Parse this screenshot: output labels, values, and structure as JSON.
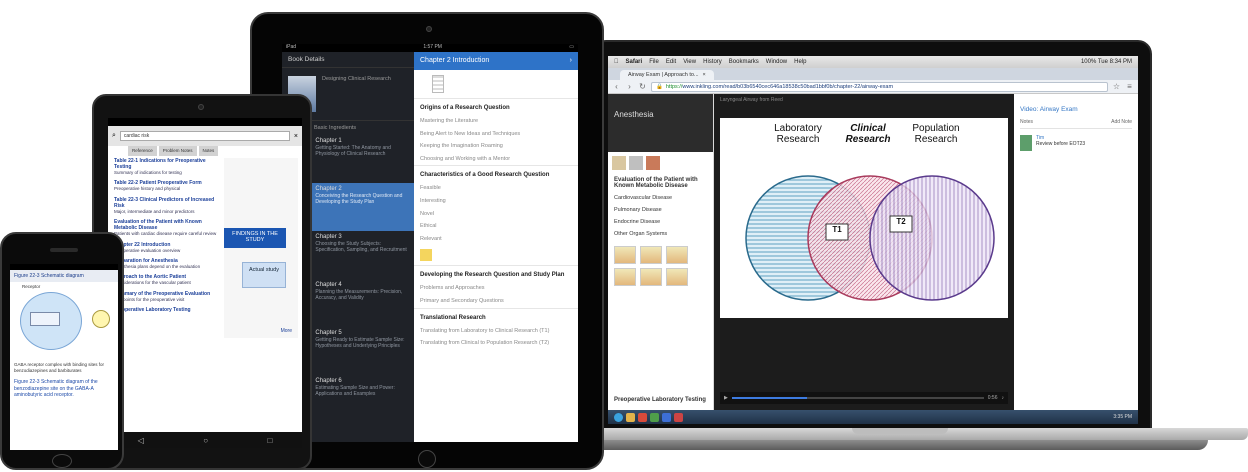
{
  "laptop": {
    "menubar": [
      "Safari",
      "File",
      "Edit",
      "View",
      "History",
      "Bookmarks",
      "Window",
      "Help"
    ],
    "menubar_right": "100%  Tue 8:34 PM",
    "tab_label": "Airway Exam | Approach to...",
    "url_scheme": "https://",
    "url": "www.inkling.com/read/b03b6540cec646a18538c50bad1bbf0b/chapter-22/airway-exam",
    "left_title": "Anesthesia",
    "left_toc": [
      {
        "text": "Evaluation of the Patient with Known Metabolic Disease",
        "bold": true
      },
      {
        "text": "Cardiovascular Disease",
        "bold": false
      },
      {
        "text": "Pulmonary Disease",
        "bold": false
      },
      {
        "text": "Endocrine Disease",
        "bold": false
      },
      {
        "text": "Other Organ Systems",
        "bold": false
      },
      {
        "text": "Preoperative Laboratory Testing",
        "bold": true
      }
    ],
    "video_header": "Laryngeal Airway from Reed",
    "venn": {
      "left": "Laboratory\nResearch",
      "center": "Clinical\nResearch",
      "right": "Population\nResearch",
      "t1": "T1",
      "t2": "T2"
    },
    "video_time": "0:56",
    "right_video_label": "Video: Airway Exam",
    "notes_label": "Notes",
    "add_note": "Add Note",
    "note_author": "Tim",
    "note_text": "Review before EOT23",
    "taskbar_time": "3:35 PM",
    "colors": {
      "accent": "#3577c5",
      "taskbar": "#2a4060"
    }
  },
  "tablet_big": {
    "status_left": "iPad",
    "status_center": "1:57 PM",
    "left_header": "Book Details",
    "book_title": "Designing Clinical Research",
    "section_label": "Section 1: Basic Ingredients",
    "chapters": [
      {
        "word": "Chapter",
        "num": "1",
        "title": "Chapter 1",
        "desc": "Getting Started: The Anatomy and Physiology of Clinical Research",
        "active": false
      },
      {
        "word": "Chapter",
        "num": "2",
        "title": "Chapter 2",
        "desc": "Conceiving the Research Question and Developing the Study Plan",
        "active": true
      },
      {
        "word": "Chapter",
        "num": "3",
        "title": "Chapter 3",
        "desc": "Choosing the Study Subjects: Specification, Sampling, and Recruitment",
        "active": false
      },
      {
        "word": "Chapter",
        "num": "4",
        "title": "Chapter 4",
        "desc": "Planning the Measurements: Precision, Accuracy, and Validity",
        "active": false
      },
      {
        "word": "Chapter",
        "num": "5",
        "title": "Chapter 5",
        "desc": "Getting Ready to Estimate Sample Size: Hypotheses and Underlying Principles",
        "active": false
      },
      {
        "word": "Chapter",
        "num": "6",
        "title": "Chapter 6",
        "desc": "Estimating Sample Size and Power: Applications and Examples",
        "active": false
      }
    ],
    "right_header": "Chapter 2 Introduction",
    "toc": [
      {
        "heading": "Origins of a Research Question",
        "items": [
          "Mastering the Literature",
          "Being Alert to New Ideas and Techniques",
          "Keeping the Imagination Roaming",
          "Choosing and Working with a Mentor"
        ]
      },
      {
        "heading": "Characteristics of a Good Research Question",
        "items": [
          "Feasible",
          "Interesting",
          "Novel",
          "Ethical",
          "Relevant"
        ]
      },
      {
        "heading": "Developing the Research Question and Study Plan",
        "items": [
          "Problems and Approaches",
          "Primary and Secondary Questions"
        ]
      },
      {
        "heading": "Translational Research",
        "items": [
          "Translating from Laboratory to Clinical Research (T1)",
          "Translating from Clinical to Population Research (T2)"
        ]
      }
    ]
  },
  "tablet_small": {
    "search_value": "cardiac risk",
    "tabs": [
      "Reference",
      "Problem Notes",
      "Notes"
    ],
    "results": [
      {
        "title": "Table 22-1 Indications for Preoperative Testing",
        "desc": "Summary of indications for testing"
      },
      {
        "title": "Table 22-2 Patient Preoperative Form",
        "desc": "Preoperative history and physical"
      },
      {
        "title": "Table 22-3 Clinical Predictors of Increased Risk",
        "desc": "Major, intermediate and minor predictors"
      },
      {
        "title": "Evaluation of the Patient with Known Metabolic Disease",
        "desc": "Patients with cardiac disease require careful review"
      },
      {
        "title": "Chapter 22 Introduction",
        "desc": "Preoperative evaluation overview"
      },
      {
        "title": "Preparation for Anesthesia",
        "desc": "Anesthesia plans depend on the evaluation"
      },
      {
        "title": "Approach to the Aortic Patient",
        "desc": "Considerations for the vascular patient"
      },
      {
        "title": "Summary of the Preoperative Evaluation",
        "desc": "Key points for the preoperative visit"
      },
      {
        "title": "Preoperative Laboratory Testing",
        "desc": ""
      }
    ],
    "panel_box1": "FINDINGS IN THE STUDY",
    "panel_box2": "Actual study",
    "panel_more": "More"
  },
  "phone": {
    "header": "Figure 22-3 Schematic diagram",
    "diagram_label": "Receptor",
    "body_text": "GABA receptor complex with binding sites for benzodiazepines and barbiturates",
    "caption": "Figure 22-3 Schematic diagram of the benzodiazepine site on the GABA-A aminobutyric acid receptor."
  }
}
